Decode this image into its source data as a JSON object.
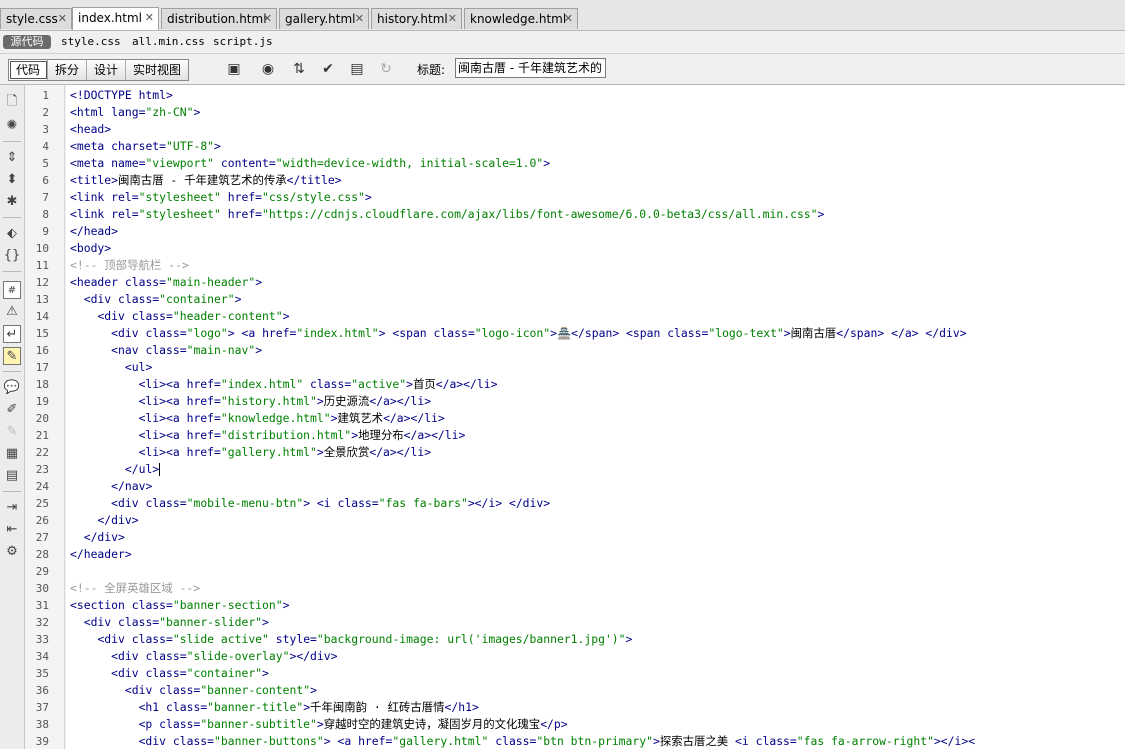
{
  "tabs": [
    {
      "label": "style.css",
      "active": false
    },
    {
      "label": "index.html",
      "active": true
    },
    {
      "label": "distribution.html",
      "active": false
    },
    {
      "label": "gallery.html",
      "active": false
    },
    {
      "label": "history.html",
      "active": false
    },
    {
      "label": "knowledge.html",
      "active": false
    }
  ],
  "related": {
    "source_label": "源代码",
    "files": [
      "style.css",
      "all.min.css",
      "script.js"
    ]
  },
  "toolbar": {
    "views": [
      "代码",
      "拆分",
      "设计",
      "实时视图"
    ],
    "title_label": "标题:",
    "title_value": "闽南古厝 - 千年建筑艺术的"
  },
  "icons": {
    "toolbar": [
      "multiscreen-icon",
      "browser-preview-icon",
      "file-transfer-icon",
      "validate-icon",
      "visual-aids-icon",
      "refresh-icon"
    ],
    "sidebar": [
      "open-documents-icon",
      "show-code-navigator-icon",
      "collapse-full-tag-icon",
      "collapse-selection-icon",
      "expand-all-icon",
      "select-parent-tag-icon",
      "balance-braces-icon",
      "line-numbers-icon",
      "highlight-invalid-code-icon",
      "syntax-coloring-icon",
      "apply-comment-icon",
      "remove-comment-icon",
      "wrap-tag-icon",
      "recent-snippets-icon",
      "move-css-icon",
      "indent-code-icon",
      "outdent-code-icon",
      "format-source-icon"
    ]
  },
  "code": {
    "lines": [
      [
        [
          "t",
          "<!DOCTYPE html>"
        ]
      ],
      [
        [
          "t",
          "<html "
        ],
        [
          "a",
          "lang="
        ],
        [
          "v",
          "\"zh-CN\""
        ],
        [
          "t",
          ">"
        ]
      ],
      [
        [
          "t",
          "<head>"
        ]
      ],
      [
        [
          "t",
          "<meta "
        ],
        [
          "a",
          "charset="
        ],
        [
          "v",
          "\"UTF-8\""
        ],
        [
          "t",
          ">"
        ]
      ],
      [
        [
          "t",
          "<meta "
        ],
        [
          "a",
          "name="
        ],
        [
          "v",
          "\"viewport\" "
        ],
        [
          "a",
          "content="
        ],
        [
          "v",
          "\"width=device-width, initial-scale=1.0\""
        ],
        [
          "t",
          ">"
        ]
      ],
      [
        [
          "t",
          "<title>"
        ],
        [
          "x0",
          "闽南古厝 - 千年建筑艺术的传承"
        ],
        [
          "t",
          "</title>"
        ]
      ],
      [
        [
          "t",
          "<link "
        ],
        [
          "a",
          "rel="
        ],
        [
          "v",
          "\"stylesheet\" "
        ],
        [
          "a",
          "href="
        ],
        [
          "v",
          "\"css/style.css\""
        ],
        [
          "t",
          ">"
        ]
      ],
      [
        [
          "t",
          "<link "
        ],
        [
          "a",
          "rel="
        ],
        [
          "v",
          "\"stylesheet\" "
        ],
        [
          "a",
          "href="
        ],
        [
          "v",
          "\"https://cdnjs.cloudflare.com/ajax/libs/font-awesome/6.0.0-beta3/css/all.min.css\""
        ],
        [
          "t",
          ">"
        ]
      ],
      [
        [
          "t",
          "</head>"
        ]
      ],
      [
        [
          "t",
          "<body>"
        ]
      ],
      [
        [
          "c",
          "<!-- 顶部导航栏 -->"
        ]
      ],
      [
        [
          "t",
          "<header "
        ],
        [
          "a",
          "class="
        ],
        [
          "v",
          "\"main-header\""
        ],
        [
          "t",
          ">"
        ]
      ],
      [
        [
          "x0",
          "  "
        ],
        [
          "t",
          "<div "
        ],
        [
          "a",
          "class="
        ],
        [
          "v",
          "\"container\""
        ],
        [
          "t",
          ">"
        ]
      ],
      [
        [
          "x0",
          "    "
        ],
        [
          "t",
          "<div "
        ],
        [
          "a",
          "class="
        ],
        [
          "v",
          "\"header-content\""
        ],
        [
          "t",
          ">"
        ]
      ],
      [
        [
          "x0",
          "      "
        ],
        [
          "t",
          "<div "
        ],
        [
          "a",
          "class="
        ],
        [
          "v",
          "\"logo\""
        ],
        [
          "t",
          "> "
        ],
        [
          "t",
          "<a "
        ],
        [
          "a",
          "href="
        ],
        [
          "v",
          "\"index.html\""
        ],
        [
          "t",
          "> "
        ],
        [
          "t",
          "<span "
        ],
        [
          "a",
          "class="
        ],
        [
          "v",
          "\"logo-icon\""
        ],
        [
          "t",
          ">"
        ],
        [
          "x0",
          "🏯"
        ],
        [
          "t",
          "</span> "
        ],
        [
          "t",
          "<span "
        ],
        [
          "a",
          "class="
        ],
        [
          "v",
          "\"logo-text\""
        ],
        [
          "t",
          ">"
        ],
        [
          "x0",
          "闽南古厝"
        ],
        [
          "t",
          "</span> "
        ],
        [
          "t",
          "</a> "
        ],
        [
          "t",
          "</div>"
        ]
      ],
      [
        [
          "x0",
          "      "
        ],
        [
          "t",
          "<nav "
        ],
        [
          "a",
          "class="
        ],
        [
          "v",
          "\"main-nav\""
        ],
        [
          "t",
          ">"
        ]
      ],
      [
        [
          "x0",
          "        "
        ],
        [
          "t",
          "<ul>"
        ]
      ],
      [
        [
          "x0",
          "          "
        ],
        [
          "t",
          "<li>"
        ],
        [
          "t",
          "<a "
        ],
        [
          "a",
          "href="
        ],
        [
          "v",
          "\"index.html\" "
        ],
        [
          "a",
          "class="
        ],
        [
          "v",
          "\"active\""
        ],
        [
          "t",
          ">"
        ],
        [
          "x0",
          "首页"
        ],
        [
          "t",
          "</a>"
        ],
        [
          "t",
          "</li>"
        ]
      ],
      [
        [
          "x0",
          "          "
        ],
        [
          "t",
          "<li>"
        ],
        [
          "t",
          "<a "
        ],
        [
          "a",
          "href="
        ],
        [
          "v",
          "\"history.html\""
        ],
        [
          "t",
          ">"
        ],
        [
          "x0",
          "历史源流"
        ],
        [
          "t",
          "</a>"
        ],
        [
          "t",
          "</li>"
        ]
      ],
      [
        [
          "x0",
          "          "
        ],
        [
          "t",
          "<li>"
        ],
        [
          "t",
          "<a "
        ],
        [
          "a",
          "href="
        ],
        [
          "v",
          "\"knowledge.html\""
        ],
        [
          "t",
          ">"
        ],
        [
          "x0",
          "建筑艺术"
        ],
        [
          "t",
          "</a>"
        ],
        [
          "t",
          "</li>"
        ]
      ],
      [
        [
          "x0",
          "          "
        ],
        [
          "t",
          "<li>"
        ],
        [
          "t",
          "<a "
        ],
        [
          "a",
          "href="
        ],
        [
          "v",
          "\"distribution.html\""
        ],
        [
          "t",
          ">"
        ],
        [
          "x0",
          "地理分布"
        ],
        [
          "t",
          "</a>"
        ],
        [
          "t",
          "</li>"
        ]
      ],
      [
        [
          "x0",
          "          "
        ],
        [
          "t",
          "<li>"
        ],
        [
          "t",
          "<a "
        ],
        [
          "a",
          "href="
        ],
        [
          "v",
          "\"gallery.html\""
        ],
        [
          "t",
          ">"
        ],
        [
          "x0",
          "全景欣赏"
        ],
        [
          "t",
          "</a>"
        ],
        [
          "t",
          "</li>"
        ]
      ],
      [
        [
          "x0",
          "        "
        ],
        [
          "t",
          "</ul>"
        ]
      ],
      [
        [
          "x0",
          "      "
        ],
        [
          "t",
          "</nav>"
        ]
      ],
      [
        [
          "x0",
          "      "
        ],
        [
          "t",
          "<div "
        ],
        [
          "a",
          "class="
        ],
        [
          "v",
          "\"mobile-menu-btn\""
        ],
        [
          "t",
          "> "
        ],
        [
          "t",
          "<i "
        ],
        [
          "a",
          "class="
        ],
        [
          "v",
          "\"fas fa-bars\""
        ],
        [
          "t",
          ">"
        ],
        [
          "t",
          "</i> "
        ],
        [
          "t",
          "</div>"
        ]
      ],
      [
        [
          "x0",
          "    "
        ],
        [
          "t",
          "</div>"
        ]
      ],
      [
        [
          "x0",
          "  "
        ],
        [
          "t",
          "</div>"
        ]
      ],
      [
        [
          "t",
          "</header>"
        ]
      ],
      [],
      [
        [
          "c",
          "<!-- 全屏英雄区域 -->"
        ]
      ],
      [
        [
          "t",
          "<section "
        ],
        [
          "a",
          "class="
        ],
        [
          "v",
          "\"banner-section\""
        ],
        [
          "t",
          ">"
        ]
      ],
      [
        [
          "x0",
          "  "
        ],
        [
          "t",
          "<div "
        ],
        [
          "a",
          "class="
        ],
        [
          "v",
          "\"banner-slider\""
        ],
        [
          "t",
          ">"
        ]
      ],
      [
        [
          "x0",
          "    "
        ],
        [
          "t",
          "<div "
        ],
        [
          "a",
          "class="
        ],
        [
          "v",
          "\"slide active\" "
        ],
        [
          "a",
          "style="
        ],
        [
          "v",
          "\"background-image: url('images/banner1.jpg')\""
        ],
        [
          "t",
          ">"
        ]
      ],
      [
        [
          "x0",
          "      "
        ],
        [
          "t",
          "<div "
        ],
        [
          "a",
          "class="
        ],
        [
          "v",
          "\"slide-overlay\""
        ],
        [
          "t",
          ">"
        ],
        [
          "t",
          "</div>"
        ]
      ],
      [
        [
          "x0",
          "      "
        ],
        [
          "t",
          "<div "
        ],
        [
          "a",
          "class="
        ],
        [
          "v",
          "\"container\""
        ],
        [
          "t",
          ">"
        ]
      ],
      [
        [
          "x0",
          "        "
        ],
        [
          "t",
          "<div "
        ],
        [
          "a",
          "class="
        ],
        [
          "v",
          "\"banner-content\""
        ],
        [
          "t",
          ">"
        ]
      ],
      [
        [
          "x0",
          "          "
        ],
        [
          "t",
          "<h1 "
        ],
        [
          "a",
          "class="
        ],
        [
          "v",
          "\"banner-title\""
        ],
        [
          "t",
          ">"
        ],
        [
          "x0",
          "千年闽南韵 · 红砖古厝情"
        ],
        [
          "t",
          "</h1>"
        ]
      ],
      [
        [
          "x0",
          "          "
        ],
        [
          "t",
          "<p "
        ],
        [
          "a",
          "class="
        ],
        [
          "v",
          "\"banner-subtitle\""
        ],
        [
          "t",
          ">"
        ],
        [
          "x0",
          "穿越时空的建筑史诗，凝固岁月的文化瑰宝"
        ],
        [
          "t",
          "</p>"
        ]
      ],
      [
        [
          "x0",
          "          "
        ],
        [
          "t",
          "<div "
        ],
        [
          "a",
          "class="
        ],
        [
          "v",
          "\"banner-buttons\""
        ],
        [
          "t",
          "> "
        ],
        [
          "t",
          "<a "
        ],
        [
          "a",
          "href="
        ],
        [
          "v",
          "\"gallery.html\" "
        ],
        [
          "a",
          "class="
        ],
        [
          "v",
          "\"btn btn-primary\""
        ],
        [
          "t",
          ">"
        ],
        [
          "x0",
          "探索古厝之美 "
        ],
        [
          "t",
          "<i "
        ],
        [
          "a",
          "class="
        ],
        [
          "v",
          "\"fas fa-arrow-right\""
        ],
        [
          "t",
          "></i><"
        ]
      ]
    ]
  }
}
